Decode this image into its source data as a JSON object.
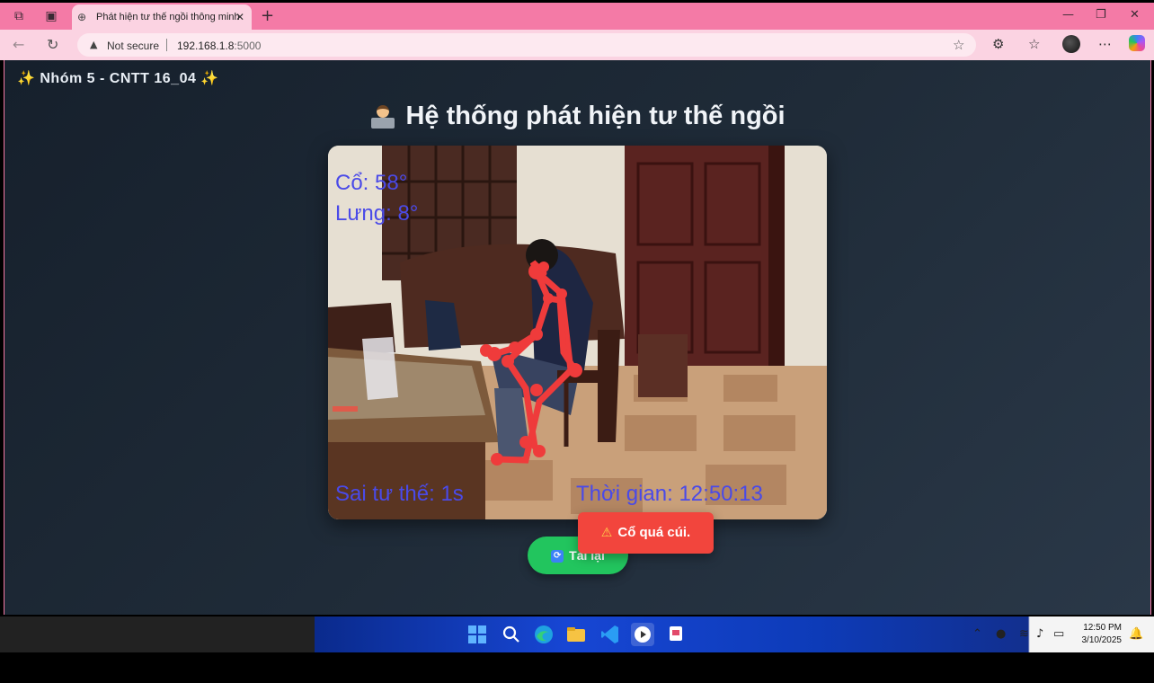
{
  "browser": {
    "tab_title": "Phát hiện tư thế ngồi thông minh",
    "security_label": "Not secure",
    "url_host": "192.168.1.8",
    "url_port": ":5000"
  },
  "page": {
    "brand": "Nhóm 5 - CNTT 16_04",
    "brand_sparkle": "✨",
    "title": "Hệ thống phát hiện tư thế ngồi",
    "video_overlay": {
      "neck": "Cổ: 58°",
      "back": "Lưng: 8°",
      "bad_posture": "Sai tư thế: 1s",
      "time": "Thời gian: 12:50:13"
    },
    "reload_label": "Tải lại",
    "toast": "Cổ quá cúi."
  },
  "taskbar": {
    "time": "12:50 PM",
    "date": "3/10/2025"
  },
  "colors": {
    "chrome_pink": "#f47aa6",
    "overlay_text": "#4a4ae8",
    "skeleton": "#ef3b3b",
    "reload_green": "#22c55e",
    "toast_red": "#f2453d"
  }
}
